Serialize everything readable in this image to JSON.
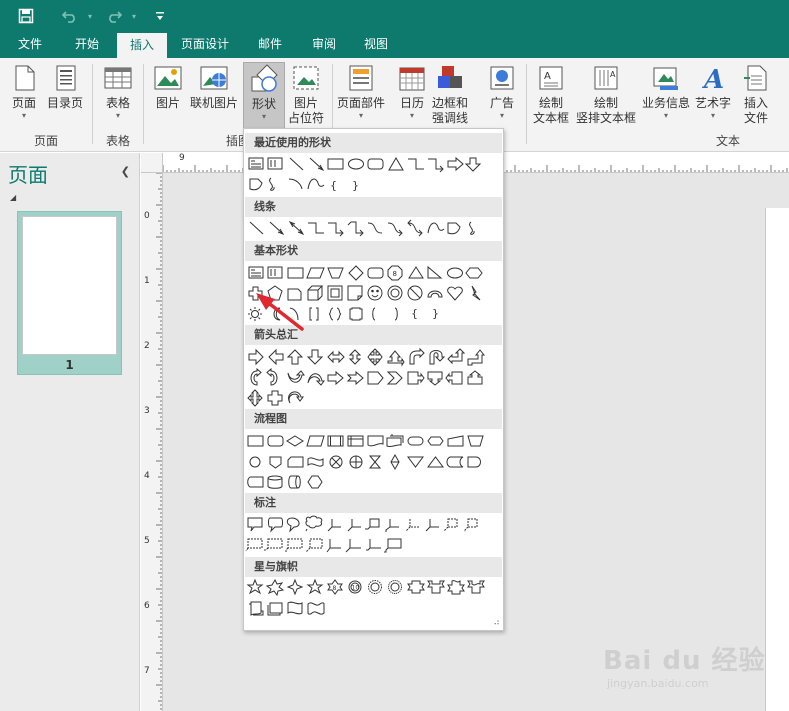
{
  "quick_access": {
    "save": "save-icon",
    "undo": "undo-icon",
    "redo": "redo-icon",
    "customize": "customize-icon"
  },
  "tabs": [
    "文件",
    "开始",
    "插入",
    "页面设计",
    "邮件",
    "审阅",
    "视图"
  ],
  "active_tab": "插入",
  "ribbon": {
    "buttons": [
      {
        "label": "页面",
        "sub": "",
        "caret": true
      },
      {
        "label": "目录页",
        "sub": "",
        "caret": false
      },
      {
        "label": "表格",
        "sub": "",
        "caret": true
      },
      {
        "label": "图片",
        "sub": "",
        "caret": false
      },
      {
        "label": "联机图片",
        "sub": "",
        "caret": false
      },
      {
        "label": "形状",
        "sub": "",
        "caret": true
      },
      {
        "label": "图片",
        "sub": "占位符",
        "caret": false
      },
      {
        "label": "页面部件",
        "sub": "",
        "caret": true
      },
      {
        "label": "日历",
        "sub": "",
        "caret": true
      },
      {
        "label": "边框和",
        "sub": "强调线",
        "caret": true
      },
      {
        "label": "广告",
        "sub": "",
        "caret": true
      },
      {
        "label": "绘制",
        "sub": "文本框",
        "caret": false
      },
      {
        "label": "绘制",
        "sub": "竖排文本框",
        "caret": false
      },
      {
        "label": "业务信息",
        "sub": "",
        "caret": true
      },
      {
        "label": "艺术字",
        "sub": "",
        "caret": true
      },
      {
        "label": "插入",
        "sub": "文件",
        "caret": false
      }
    ],
    "groups": [
      "页面",
      "表格",
      "插图",
      "文本"
    ]
  },
  "left_pane": {
    "title": "页面",
    "page_number": "1"
  },
  "ruler": {
    "h_label": "9",
    "v_labels": [
      "0",
      "1",
      "2",
      "3",
      "4",
      "5",
      "6",
      "7"
    ]
  },
  "shapes_menu": {
    "sections": [
      "最近使用的形状",
      "线条",
      "基本形状",
      "箭头总汇",
      "流程图",
      "标注",
      "星与旗帜"
    ]
  },
  "watermark": {
    "logo": "Bai du 经验",
    "url": "jingyan.baidu.com"
  },
  "colors": {
    "accent": "#0e7a6e",
    "ribbon_bg": "#f3f3f3",
    "selection": "#c6c6c6",
    "arrow": "#e0282e"
  }
}
